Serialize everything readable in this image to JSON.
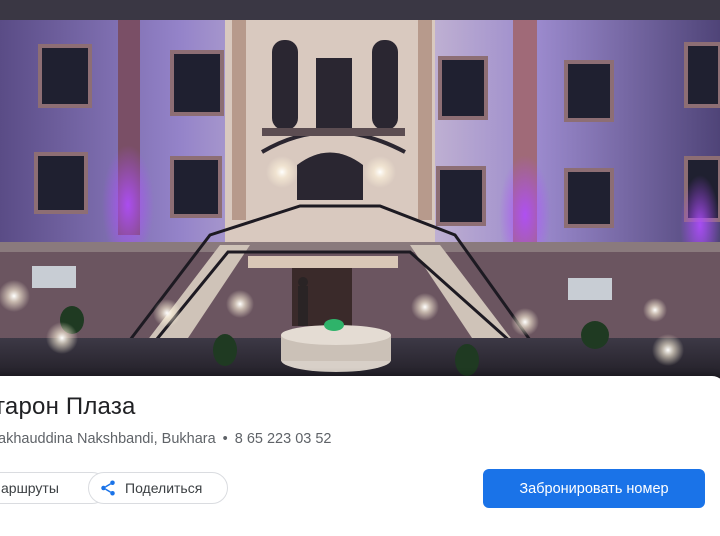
{
  "place": {
    "name": "тарон Плаза",
    "address": "akhauddina Nakshbandi, Bukhara",
    "separator": "•",
    "phone": "8 65 223 03 52"
  },
  "actions": {
    "routes_label": "аршруты",
    "share_label": "Поделиться",
    "share_icon": "share-icon",
    "book_label": "Забронировать номер"
  },
  "colors": {
    "accent": "#1a73e8",
    "facade_light": "#8b78c9",
    "facade_dark": "#2d2840"
  }
}
